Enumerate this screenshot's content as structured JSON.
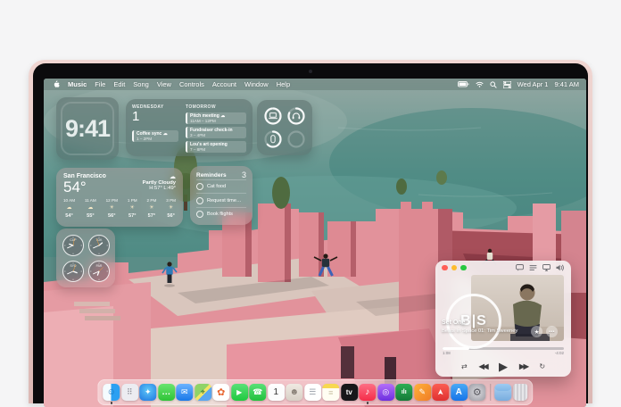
{
  "menu_bar": {
    "items": [
      "Music",
      "File",
      "Edit",
      "Song",
      "View",
      "Controls",
      "Account",
      "Window",
      "Help"
    ],
    "date": "Wed Apr 1",
    "time": "9:41 AM"
  },
  "widgets": {
    "clock": {
      "time": "9:41"
    },
    "calendar": {
      "day_label": "WEDNESDAY",
      "day_number": "1",
      "today_event": {
        "title": "Coffee sync",
        "icon": "☁",
        "time": "1 – 2PM"
      },
      "tomorrow_label": "TOMORROW",
      "tomorrow_events": [
        {
          "title": "Pitch meeting",
          "icon": "☁",
          "time": "11AM – 12PM"
        },
        {
          "title": "Fundraiser check-in",
          "icon": "",
          "time": "3 – 4PM"
        },
        {
          "title": "Lou's art opening",
          "icon": "",
          "time": "7 – 8PM"
        }
      ]
    },
    "batteries": {
      "laptop_pct": 97,
      "headphones_pct": 82,
      "mouse_pct": 63
    },
    "weather": {
      "city": "San Francisco",
      "temperature": "54°",
      "icon": "☁",
      "condition": "Partly Cloudy",
      "high_low": "H:57° L:49°",
      "hours": [
        {
          "label": "10 AM",
          "icon": "☁",
          "temp": "54°"
        },
        {
          "label": "11 AM",
          "icon": "☁",
          "temp": "55°"
        },
        {
          "label": "12 PM",
          "icon": "☀",
          "temp": "56°"
        },
        {
          "label": "1 PM",
          "icon": "☀",
          "temp": "57°"
        },
        {
          "label": "2 PM",
          "icon": "☀",
          "temp": "57°"
        },
        {
          "label": "3 PM",
          "icon": "☀",
          "temp": "56°"
        }
      ]
    },
    "reminders": {
      "title": "Reminders",
      "count": "3",
      "items": [
        "Cat food",
        "Request time…",
        "Book flights"
      ]
    },
    "world_clock": {
      "cities": [
        "CUP",
        "TOK",
        "SYD",
        "PAR"
      ]
    }
  },
  "music_player": {
    "logo": "B|S",
    "song": "Set One",
    "album_line": "Beats In Space 01: Tim Sweeney",
    "star": "★",
    "more": "•••",
    "elapsed": "1:08",
    "remaining": "-4:02",
    "progress_pct": 22,
    "shuffle": "⇄",
    "prev": "◀◀",
    "play": "▶",
    "next": "▶▶",
    "repeat": "↻"
  },
  "dock": {
    "items": [
      {
        "name": "finder",
        "glyph": "☺"
      },
      {
        "name": "launchpad",
        "glyph": "⠿"
      },
      {
        "name": "safari",
        "glyph": "✦"
      },
      {
        "name": "messages",
        "glyph": "…"
      },
      {
        "name": "mail",
        "glyph": "✉"
      },
      {
        "name": "maps",
        "glyph": "⌖"
      },
      {
        "name": "photos",
        "glyph": "✿"
      },
      {
        "name": "facetime",
        "glyph": "▶"
      },
      {
        "name": "phone",
        "glyph": "☎"
      },
      {
        "name": "calendar",
        "glyph": "1"
      },
      {
        "name": "contacts",
        "glyph": "☻"
      },
      {
        "name": "reminders",
        "glyph": "☰"
      },
      {
        "name": "notes",
        "glyph": "≡"
      },
      {
        "name": "tv",
        "glyph": "tv"
      },
      {
        "name": "music",
        "glyph": "♪"
      },
      {
        "name": "podcasts",
        "glyph": "◎"
      },
      {
        "name": "stocks",
        "glyph": "ılı"
      },
      {
        "name": "pages",
        "glyph": "✎"
      },
      {
        "name": "rocket",
        "glyph": "➤"
      },
      {
        "name": "app-store",
        "glyph": "A"
      },
      {
        "name": "settings",
        "glyph": "⚙"
      },
      {
        "name": "downloads",
        "glyph": ""
      },
      {
        "name": "trash",
        "glyph": ""
      }
    ]
  },
  "colors": {
    "wall_pink": "#e2929b",
    "sea_teal": "#55918a",
    "frame_rose": "#e7c6c2"
  }
}
